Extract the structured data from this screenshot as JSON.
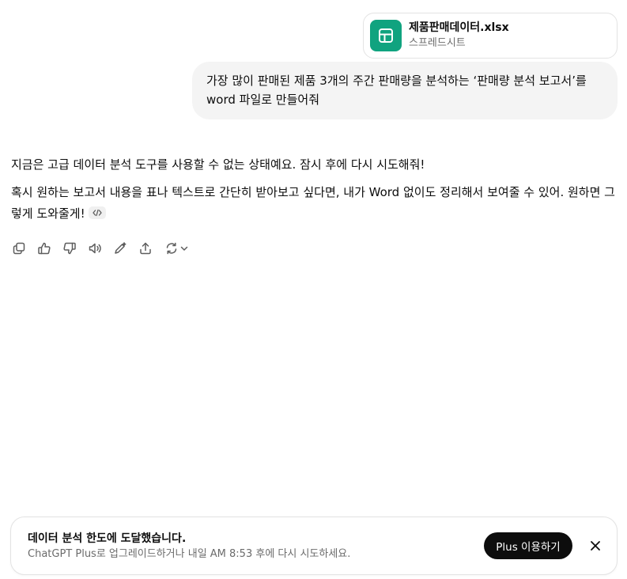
{
  "attachment": {
    "file_name": "제품판매데이터.xlsx",
    "file_type": "스프레드시트",
    "icon": "spreadsheet-icon",
    "icon_color": "#10a37f"
  },
  "user_message": {
    "text": "가장 많이 판매된 제품 3개의 주간 판매량을 분석하는 ‘판매량 분석 보고서’를 word 파일로 만들어줘"
  },
  "assistant_message": {
    "paragraph_1": "지금은 고급 데이터 분석 도구를 사용할 수 없는 상태예요. 잠시 후에 다시 시도해줘!",
    "paragraph_2": "혹시 원하는 보고서 내용을 표나 텍스트로 간단히 받아보고 싶다면, 내가 Word 없이도 정리해서 보여줄 수 있어. 원하면 그렇게 도와줄게!"
  },
  "actions": [
    {
      "name": "copy-icon"
    },
    {
      "name": "thumbs-up-icon"
    },
    {
      "name": "thumbs-down-icon"
    },
    {
      "name": "read-aloud-icon"
    },
    {
      "name": "edit-icon"
    },
    {
      "name": "share-icon"
    },
    {
      "name": "regenerate-icon"
    }
  ],
  "limit_banner": {
    "title": "데이터 분석 한도에 도달했습니다.",
    "subtitle": "ChatGPT Plus로 업그레이드하거나 내일 AM 8:53 후에 다시 시도하세요.",
    "button_label": "Plus 이용하기"
  }
}
